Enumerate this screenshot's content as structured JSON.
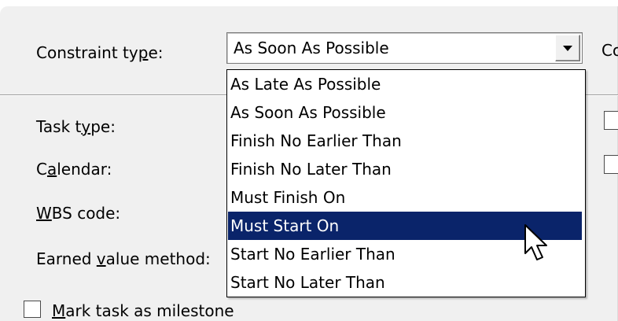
{
  "dialog": {
    "constraint_type_label_pre": "Constraint ty",
    "constraint_type_label_key": "p",
    "constraint_type_label_post": "e:",
    "task_type_label_pre": "Task t",
    "task_type_label_key": "y",
    "task_type_label_post": "pe:",
    "calendar_label_pre": "C",
    "calendar_label_key": "a",
    "calendar_label_post": "lendar:",
    "wbs_label_key": "W",
    "wbs_label_post": "BS code:",
    "earned_value_label_pre": "Earned ",
    "earned_value_label_key": "v",
    "earned_value_label_post": "alue method:",
    "milestone_label_key": "M",
    "milestone_label_post": "ark task as milestone",
    "cut_off_right_label": "Co"
  },
  "constraint_combo": {
    "selected_value": "As Soon As Possible",
    "options": [
      "As Late As Possible",
      "As Soon As Possible",
      "Finish No Earlier Than",
      "Finish No Later Than",
      "Must Finish On",
      "Must Start On",
      "Start No Earlier Than",
      "Start No Later Than"
    ],
    "highlighted_option": "Must Start On"
  },
  "colors": {
    "dialog_bg": "#f0f0f0",
    "highlight_bg": "#0a246a",
    "highlight_text": "#ffffff"
  },
  "icons": [
    "dropdown-arrow-icon",
    "mouse-pointer-icon"
  ]
}
